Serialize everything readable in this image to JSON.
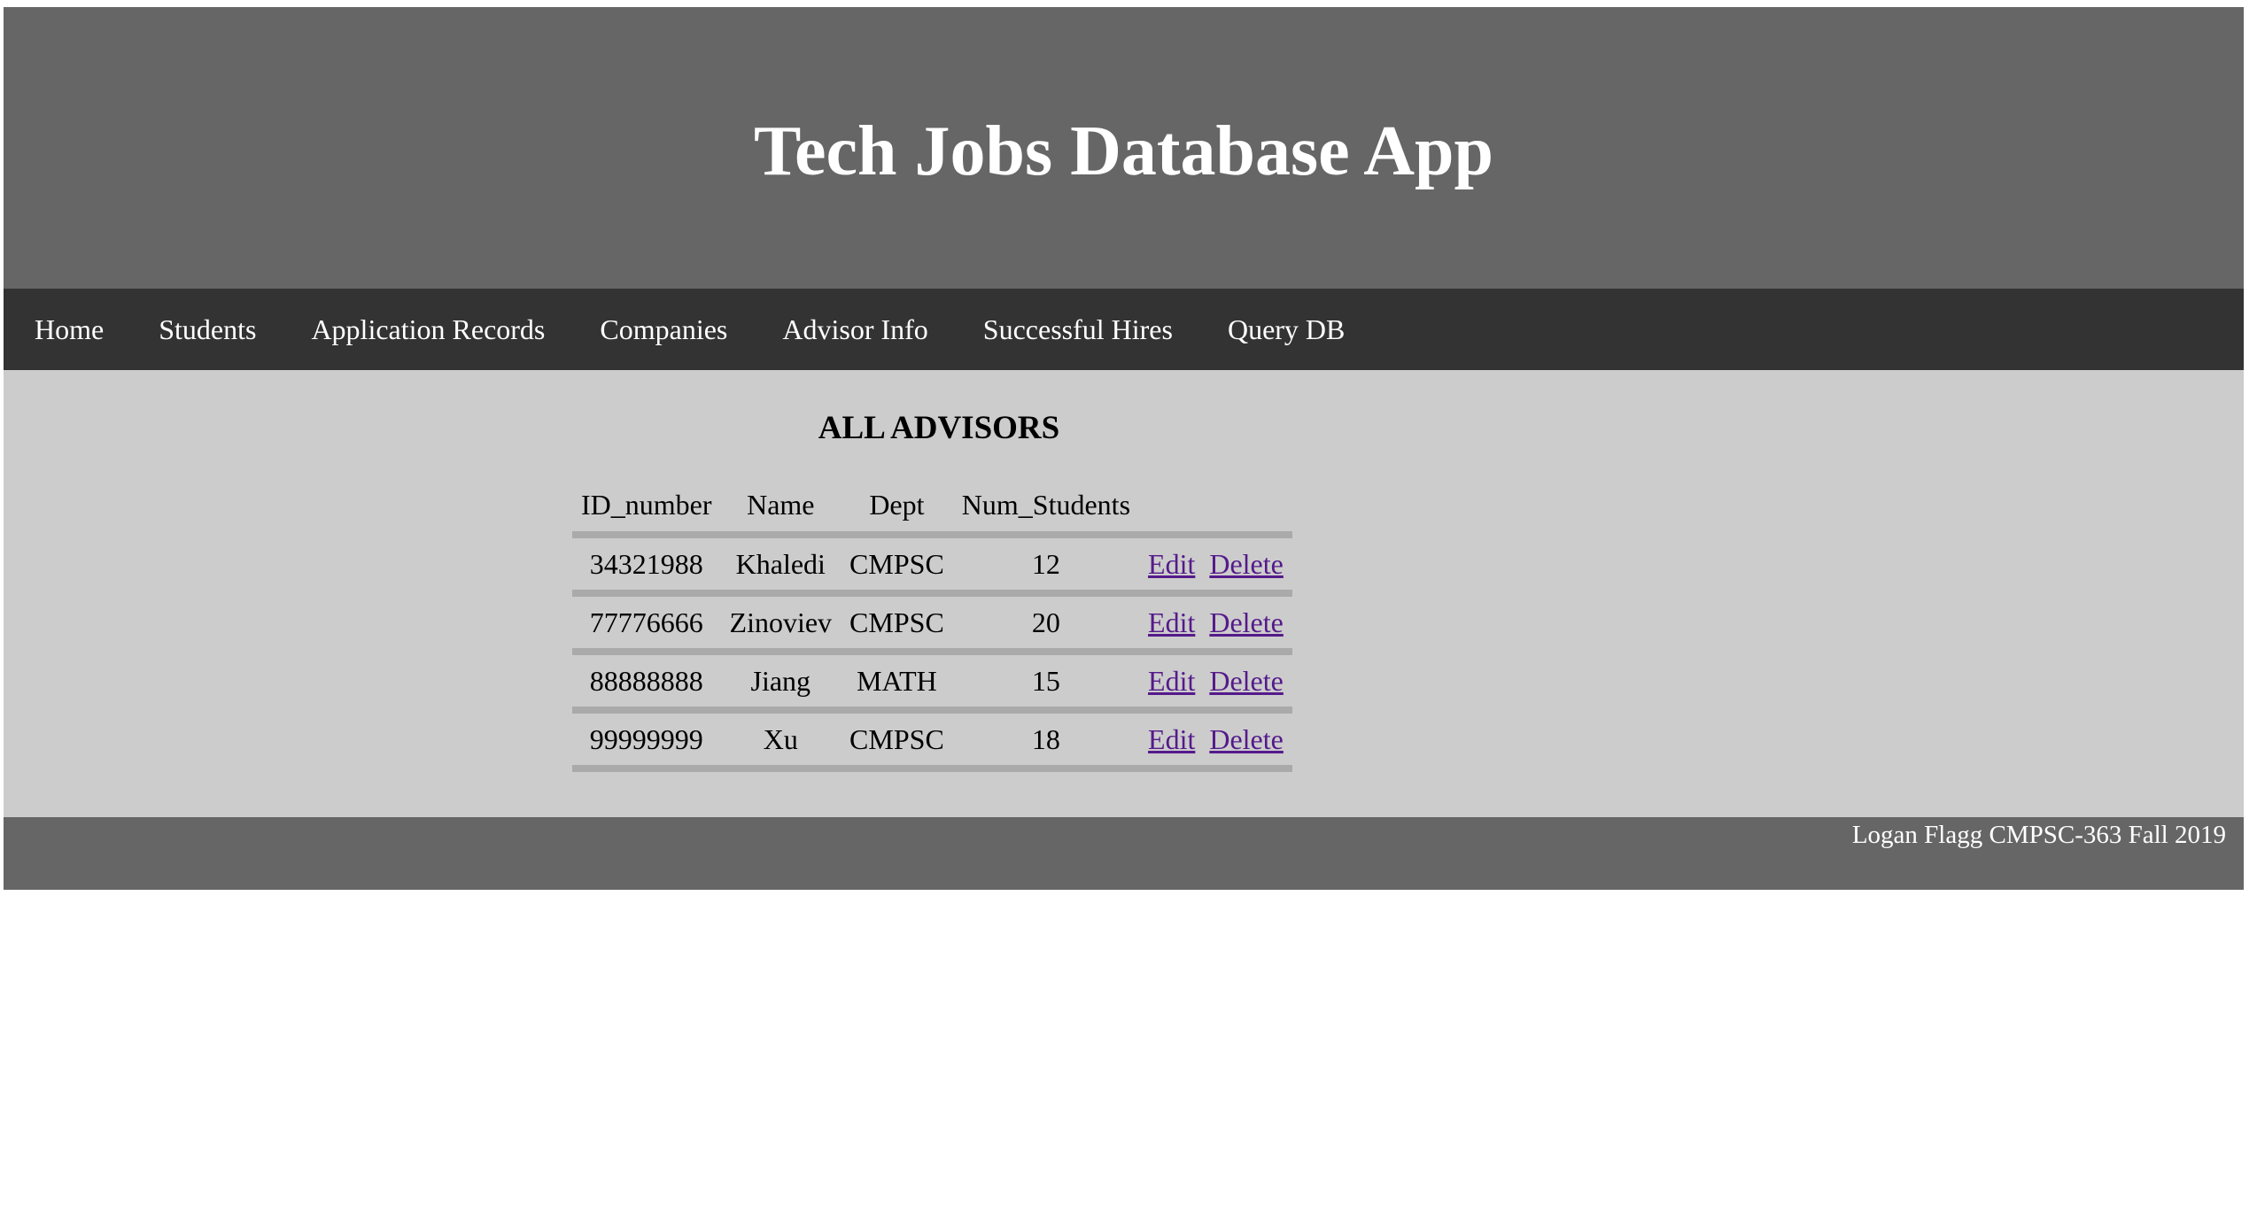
{
  "header": {
    "title": "Tech Jobs Database App"
  },
  "nav": {
    "items": [
      {
        "label": "Home"
      },
      {
        "label": "Students"
      },
      {
        "label": "Application Records"
      },
      {
        "label": "Companies"
      },
      {
        "label": "Advisor Info"
      },
      {
        "label": "Successful Hires"
      },
      {
        "label": "Query DB"
      }
    ]
  },
  "main": {
    "heading": "ALL ADVISORS",
    "table": {
      "columns": [
        "ID_number",
        "Name",
        "Dept",
        "Num_Students"
      ],
      "rows": [
        {
          "id": "34321988",
          "name": "Khaledi",
          "dept": "CMPSC",
          "num": "12",
          "edit": "Edit",
          "delete": "Delete"
        },
        {
          "id": "77776666",
          "name": "Zinoviev",
          "dept": "CMPSC",
          "num": "20",
          "edit": "Edit",
          "delete": "Delete"
        },
        {
          "id": "88888888",
          "name": "Jiang",
          "dept": "MATH",
          "num": "15",
          "edit": "Edit",
          "delete": "Delete"
        },
        {
          "id": "99999999",
          "name": "Xu",
          "dept": "CMPSC",
          "num": "18",
          "edit": "Edit",
          "delete": "Delete"
        }
      ]
    }
  },
  "footer": {
    "text": "Logan Flagg CMPSC-363 Fall 2019"
  },
  "colors": {
    "header_bg": "#666666",
    "nav_bg": "#333333",
    "content_bg": "#cccccc",
    "row_border": "#aaaaaa",
    "link": "#551a8b"
  }
}
